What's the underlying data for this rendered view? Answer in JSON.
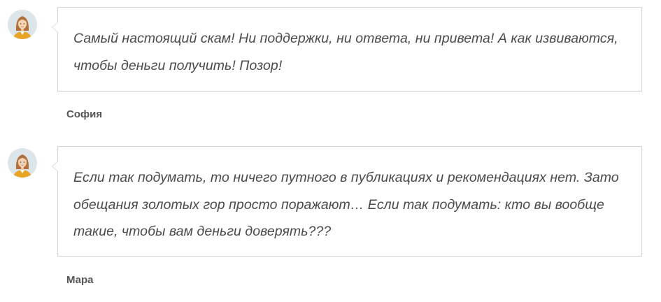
{
  "comments": [
    {
      "text": "Самый настоящий скам! Ни поддержки, ни ответа, ни привета! А как извиваются, чтобы деньги получить! Позор!",
      "author": "София",
      "avatar_icon": "female-user-avatar-icon"
    },
    {
      "text": "Если так подумать, то ничего путного в публикациях и рекомендациях нет. Зато обещания золотых гор просто поражают… Если так подумать: кто вы вообще такие, чтобы вам деньги доверять???",
      "author": "Мара",
      "avatar_icon": "female-user-avatar-icon"
    }
  ],
  "colors": {
    "text": "#4a4a4a",
    "author": "#555555",
    "border": "#d4d4d4",
    "avatar_bg": "#dbe5ea",
    "hair": "#b5703a",
    "skin": "#f6d3b4",
    "shirt": "#e8a425"
  }
}
